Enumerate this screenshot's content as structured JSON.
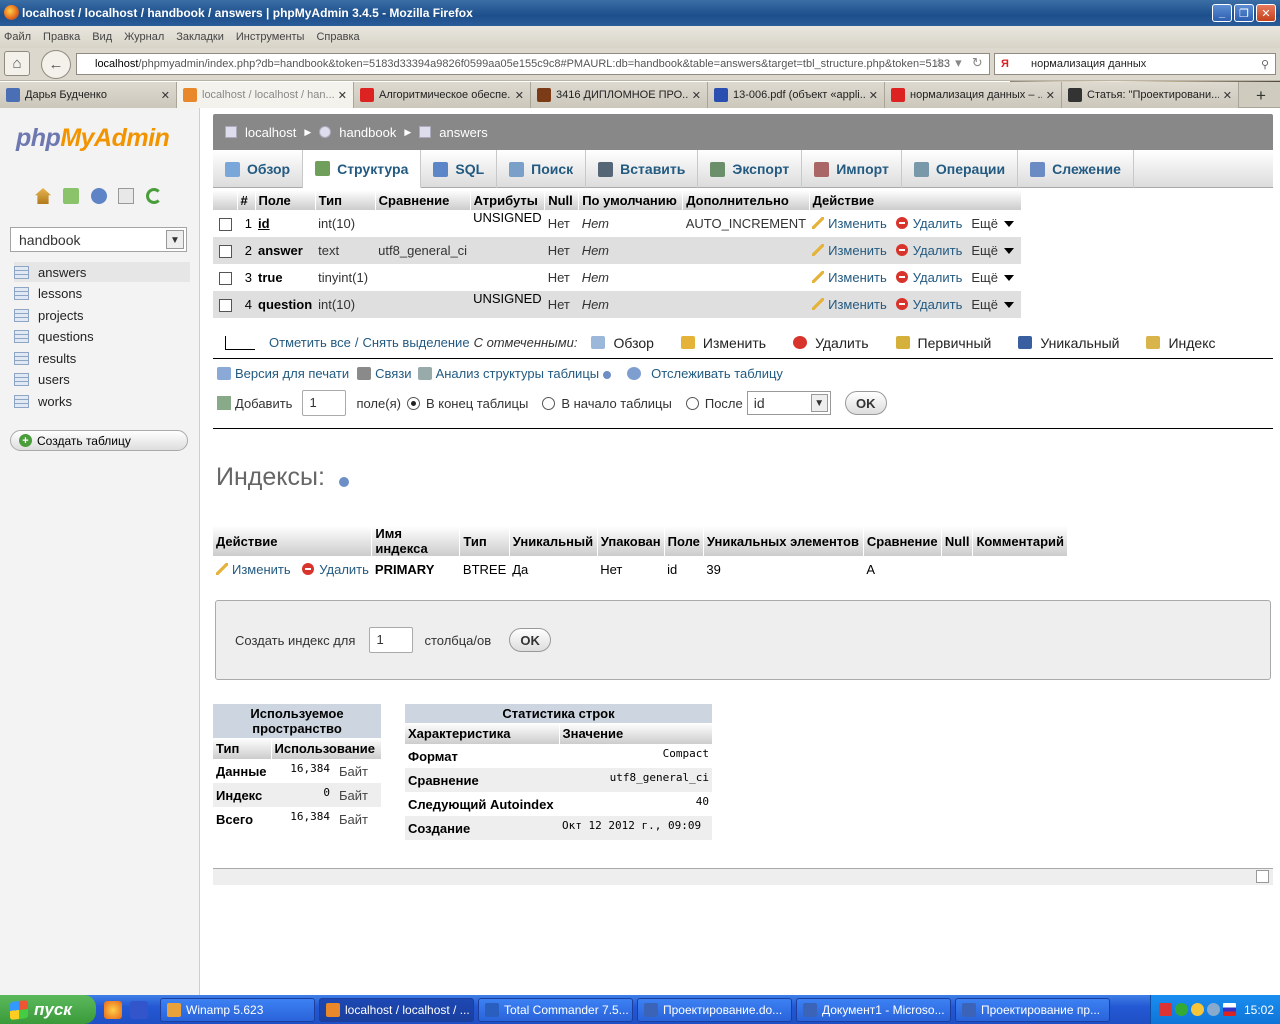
{
  "window": {
    "title": "localhost / localhost / handbook / answers | phpMyAdmin 3.4.5 - Mozilla Firefox"
  },
  "menubar": [
    "Файл",
    "Правка",
    "Вид",
    "Журнал",
    "Закладки",
    "Инструменты",
    "Справка"
  ],
  "url": {
    "host": "localhost",
    "path": "/phpmyadmin/index.php?db=handbook&token=5183d33394a9826f0599aa05e155c9c8#PMAURL:db=handbook&table=answers&target=tbl_structure.php&token=5183"
  },
  "search": {
    "value": "нормализация данных"
  },
  "tabs": [
    {
      "label": "Дарья Будченко",
      "color": "#4a6fb5"
    },
    {
      "label": "localhost / localhost / han...",
      "color": "#e9882b"
    },
    {
      "label": "Алгоритмическое обеспе...",
      "color": "#d22"
    },
    {
      "label": "3416 ДИПЛОМНОЕ ПРО...",
      "color": "#7a3b16"
    },
    {
      "label": "13-006.pdf (объект «appli...",
      "color": "#2a4fb0"
    },
    {
      "label": "нормализация данных – ...",
      "color": "#d22"
    },
    {
      "label": "Статья: \"Проектировани...",
      "color": "#333"
    }
  ],
  "sidebar": {
    "logo_php": "php",
    "logo_my": "MyAdmin",
    "db": "handbook",
    "tables": [
      "answers",
      "lessons",
      "projects",
      "questions",
      "results",
      "users",
      "works"
    ],
    "create": "Создать таблицу"
  },
  "breadcrumb": [
    "localhost",
    "handbook",
    "answers"
  ],
  "topmenu": [
    {
      "label": "Обзор",
      "color": "#7aa7d9"
    },
    {
      "label": "Структура",
      "color": "#6f9f5a"
    },
    {
      "label": "SQL",
      "color": "#5b86c7"
    },
    {
      "label": "Поиск",
      "color": "#7aa0c9"
    },
    {
      "label": "Вставить",
      "color": "#567"
    },
    {
      "label": "Экспорт",
      "color": "#6a8f6a"
    },
    {
      "label": "Импорт",
      "color": "#a66"
    },
    {
      "label": "Операции",
      "color": "#79a"
    },
    {
      "label": "Слежение",
      "color": "#6b8bc4"
    }
  ],
  "fields": {
    "headers": [
      "#",
      "Поле",
      "Тип",
      "Сравнение",
      "Атрибуты",
      "Null",
      "По умолчанию",
      "Дополнительно",
      "Действие"
    ],
    "rows": [
      {
        "n": "1",
        "name": "id",
        "type": "int(10)",
        "collation": "",
        "attrs": "UNSIGNED",
        "null": "Нет",
        "default": "Нет",
        "extra": "AUTO_INCREMENT"
      },
      {
        "n": "2",
        "name": "answer",
        "type": "text",
        "collation": "utf8_general_ci",
        "attrs": "",
        "null": "Нет",
        "default": "Нет",
        "extra": ""
      },
      {
        "n": "3",
        "name": "true",
        "type": "tinyint(1)",
        "collation": "",
        "attrs": "",
        "null": "Нет",
        "default": "Нет",
        "extra": ""
      },
      {
        "n": "4",
        "name": "question",
        "type": "int(10)",
        "collation": "",
        "attrs": "UNSIGNED",
        "null": "Нет",
        "default": "Нет",
        "extra": ""
      }
    ],
    "edit": "Изменить",
    "drop": "Удалить",
    "more": "Ещё"
  },
  "with_selected": {
    "check_all": "Отметить все",
    "sep": "/",
    "uncheck": "Снять выделение",
    "label": "С отмеченными:",
    "actions": [
      {
        "label": "Обзор",
        "color": "#9bb7d9"
      },
      {
        "label": "Изменить",
        "color": "#e5b23a"
      },
      {
        "label": "Удалить",
        "color": "#d9342b"
      },
      {
        "label": "Первичный",
        "color": "#d5b13c"
      },
      {
        "label": "Уникальный",
        "color": "#3a5fa0"
      },
      {
        "label": "Индекс",
        "color": "#d9b44a"
      }
    ]
  },
  "links": {
    "print": "Версия для печати",
    "relations": "Связи",
    "analyze": "Анализ структуры таблицы",
    "track": "Отслеживать таблицу"
  },
  "addrow": {
    "label": "Добавить",
    "count": "1",
    "unit": "поле(я)",
    "at_end": "В конец таблицы",
    "at_begin": "В начало таблицы",
    "after": "После",
    "after_field": "id",
    "ok": "OK"
  },
  "indexes": {
    "title": "Индексы:",
    "headers": [
      "Действие",
      "Имя индекса",
      "Тип",
      "Уникальный",
      "Упакован",
      "Поле",
      "Уникальных элементов",
      "Сравнение",
      "Null",
      "Комментарий"
    ],
    "row": {
      "edit": "Изменить",
      "drop": "Удалить",
      "name": "PRIMARY",
      "type": "BTREE",
      "unique": "Да",
      "packed": "Нет",
      "field": "id",
      "cardinality": "39",
      "collation": "A",
      "null": "",
      "comment": ""
    },
    "create_label": "Создать индекс для",
    "create_count": "1",
    "create_unit": "столбца/ов",
    "ok": "OK"
  },
  "space": {
    "title": "Используемое пространство",
    "headers": [
      "Тип",
      "Использование"
    ],
    "rows": [
      {
        "k": "Данные",
        "v": "16,384",
        "u": "Байт"
      },
      {
        "k": "Индекс",
        "v": "0",
        "u": "Байт"
      },
      {
        "k": "Всего",
        "v": "16,384",
        "u": "Байт"
      }
    ]
  },
  "rowstats": {
    "title": "Статистика строк",
    "headers": [
      "Характеристика",
      "Значение"
    ],
    "rows": [
      {
        "k": "Формат",
        "v": "Compact"
      },
      {
        "k": "Сравнение",
        "v": "utf8_general_ci"
      },
      {
        "k": "Следующий Autoindex",
        "v": "40"
      },
      {
        "k": "Создание",
        "v": "Окт 12 2012 г., 09:09"
      }
    ]
  },
  "taskbar": {
    "start": "пуск",
    "tasks": [
      {
        "label": "Winamp 5.623",
        "color": "#e9a23a"
      },
      {
        "label": "localhost / localhost / ...",
        "color": "#e9882b"
      },
      {
        "label": "Total Commander 7.5...",
        "color": "#2a5fc0"
      },
      {
        "label": "Проектирование.do...",
        "color": "#3b64b8"
      },
      {
        "label": "Документ1 - Microso...",
        "color": "#3b64b8"
      },
      {
        "label": "Проектирование пр...",
        "color": "#3b64b8"
      }
    ],
    "clock": "15:02"
  }
}
